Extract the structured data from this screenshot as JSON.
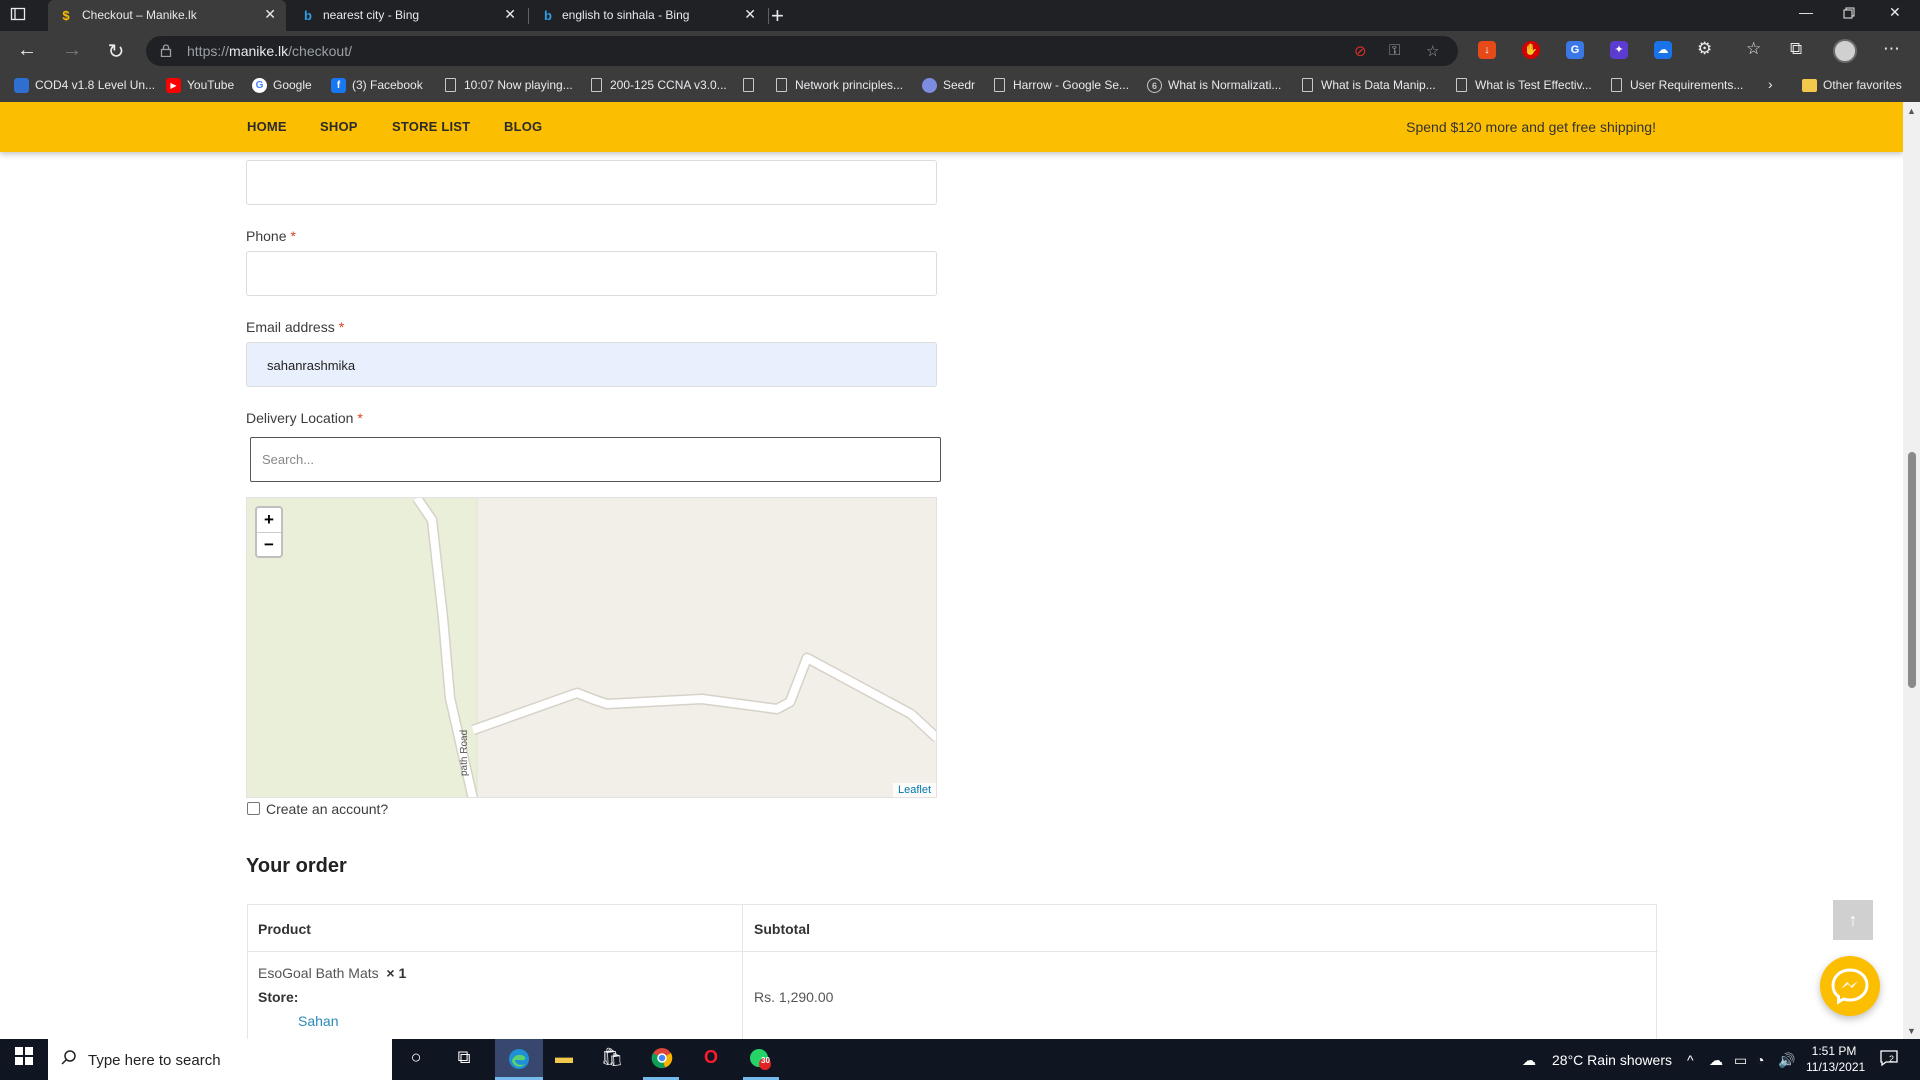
{
  "browser": {
    "tabs": [
      {
        "title": "Checkout – Manike.lk",
        "active": true
      },
      {
        "title": "nearest city - Bing",
        "active": false
      },
      {
        "title": "english to sinhala - Bing",
        "active": false
      }
    ],
    "url_prefix": "https://",
    "url_host": "manike.lk",
    "url_path": "/checkout/",
    "bookmarks": [
      {
        "label": "COD4 v1.8 Level Un...",
        "icon": "document-blue-icon"
      },
      {
        "label": "YouTube",
        "icon": "youtube-icon"
      },
      {
        "label": "Google",
        "icon": "google-icon"
      },
      {
        "label": "(3) Facebook",
        "icon": "facebook-icon"
      },
      {
        "label": "10:07 Now playing...",
        "icon": "page-icon"
      },
      {
        "label": "200-125 CCNA v3.0...",
        "icon": "page-icon"
      },
      {
        "label": "",
        "icon": "page-icon"
      },
      {
        "label": "Network principles...",
        "icon": "page-icon"
      },
      {
        "label": "Seedr",
        "icon": "seedr-icon"
      },
      {
        "label": "Harrow - Google Se...",
        "icon": "page-icon"
      },
      {
        "label": "What is Normalizati...",
        "icon": "globe-icon"
      },
      {
        "label": "What is Data Manip...",
        "icon": "page-icon"
      },
      {
        "label": "What is Test Effectiv...",
        "icon": "page-icon"
      },
      {
        "label": "User Requirements...",
        "icon": "page-icon"
      }
    ],
    "other_favorites": "Other favorites"
  },
  "site": {
    "nav": [
      "HOME",
      "SHOP",
      "STORE LIST",
      "BLOG"
    ],
    "promo": "Spend $120 more and get free shipping!",
    "accent": "#fcbe00"
  },
  "form": {
    "phone_label": "Phone",
    "email_label": "Email address",
    "email_value": "sahanrashmika",
    "delivery_label": "Delivery Location",
    "required_mark": "*",
    "search_placeholder": "Search...",
    "map_zoom_in": "+",
    "map_zoom_out": "−",
    "map_road_label": "path Road",
    "map_attribution": "Leaflet",
    "create_account_label": "Create an account?"
  },
  "order": {
    "title": "Your order",
    "col_product": "Product",
    "col_subtotal": "Subtotal",
    "product_name": "EsoGoal Bath Mats",
    "product_qty": "× 1",
    "store_label": "Store:",
    "store_name": "Sahan",
    "subtotal": "Rs. 1,290.00"
  },
  "taskbar": {
    "search_placeholder": "Type here to search",
    "weather": "28°C  Rain showers",
    "time": "1:51 PM",
    "date": "11/13/2021",
    "whatsapp_badge": "30",
    "notifications": "2"
  }
}
